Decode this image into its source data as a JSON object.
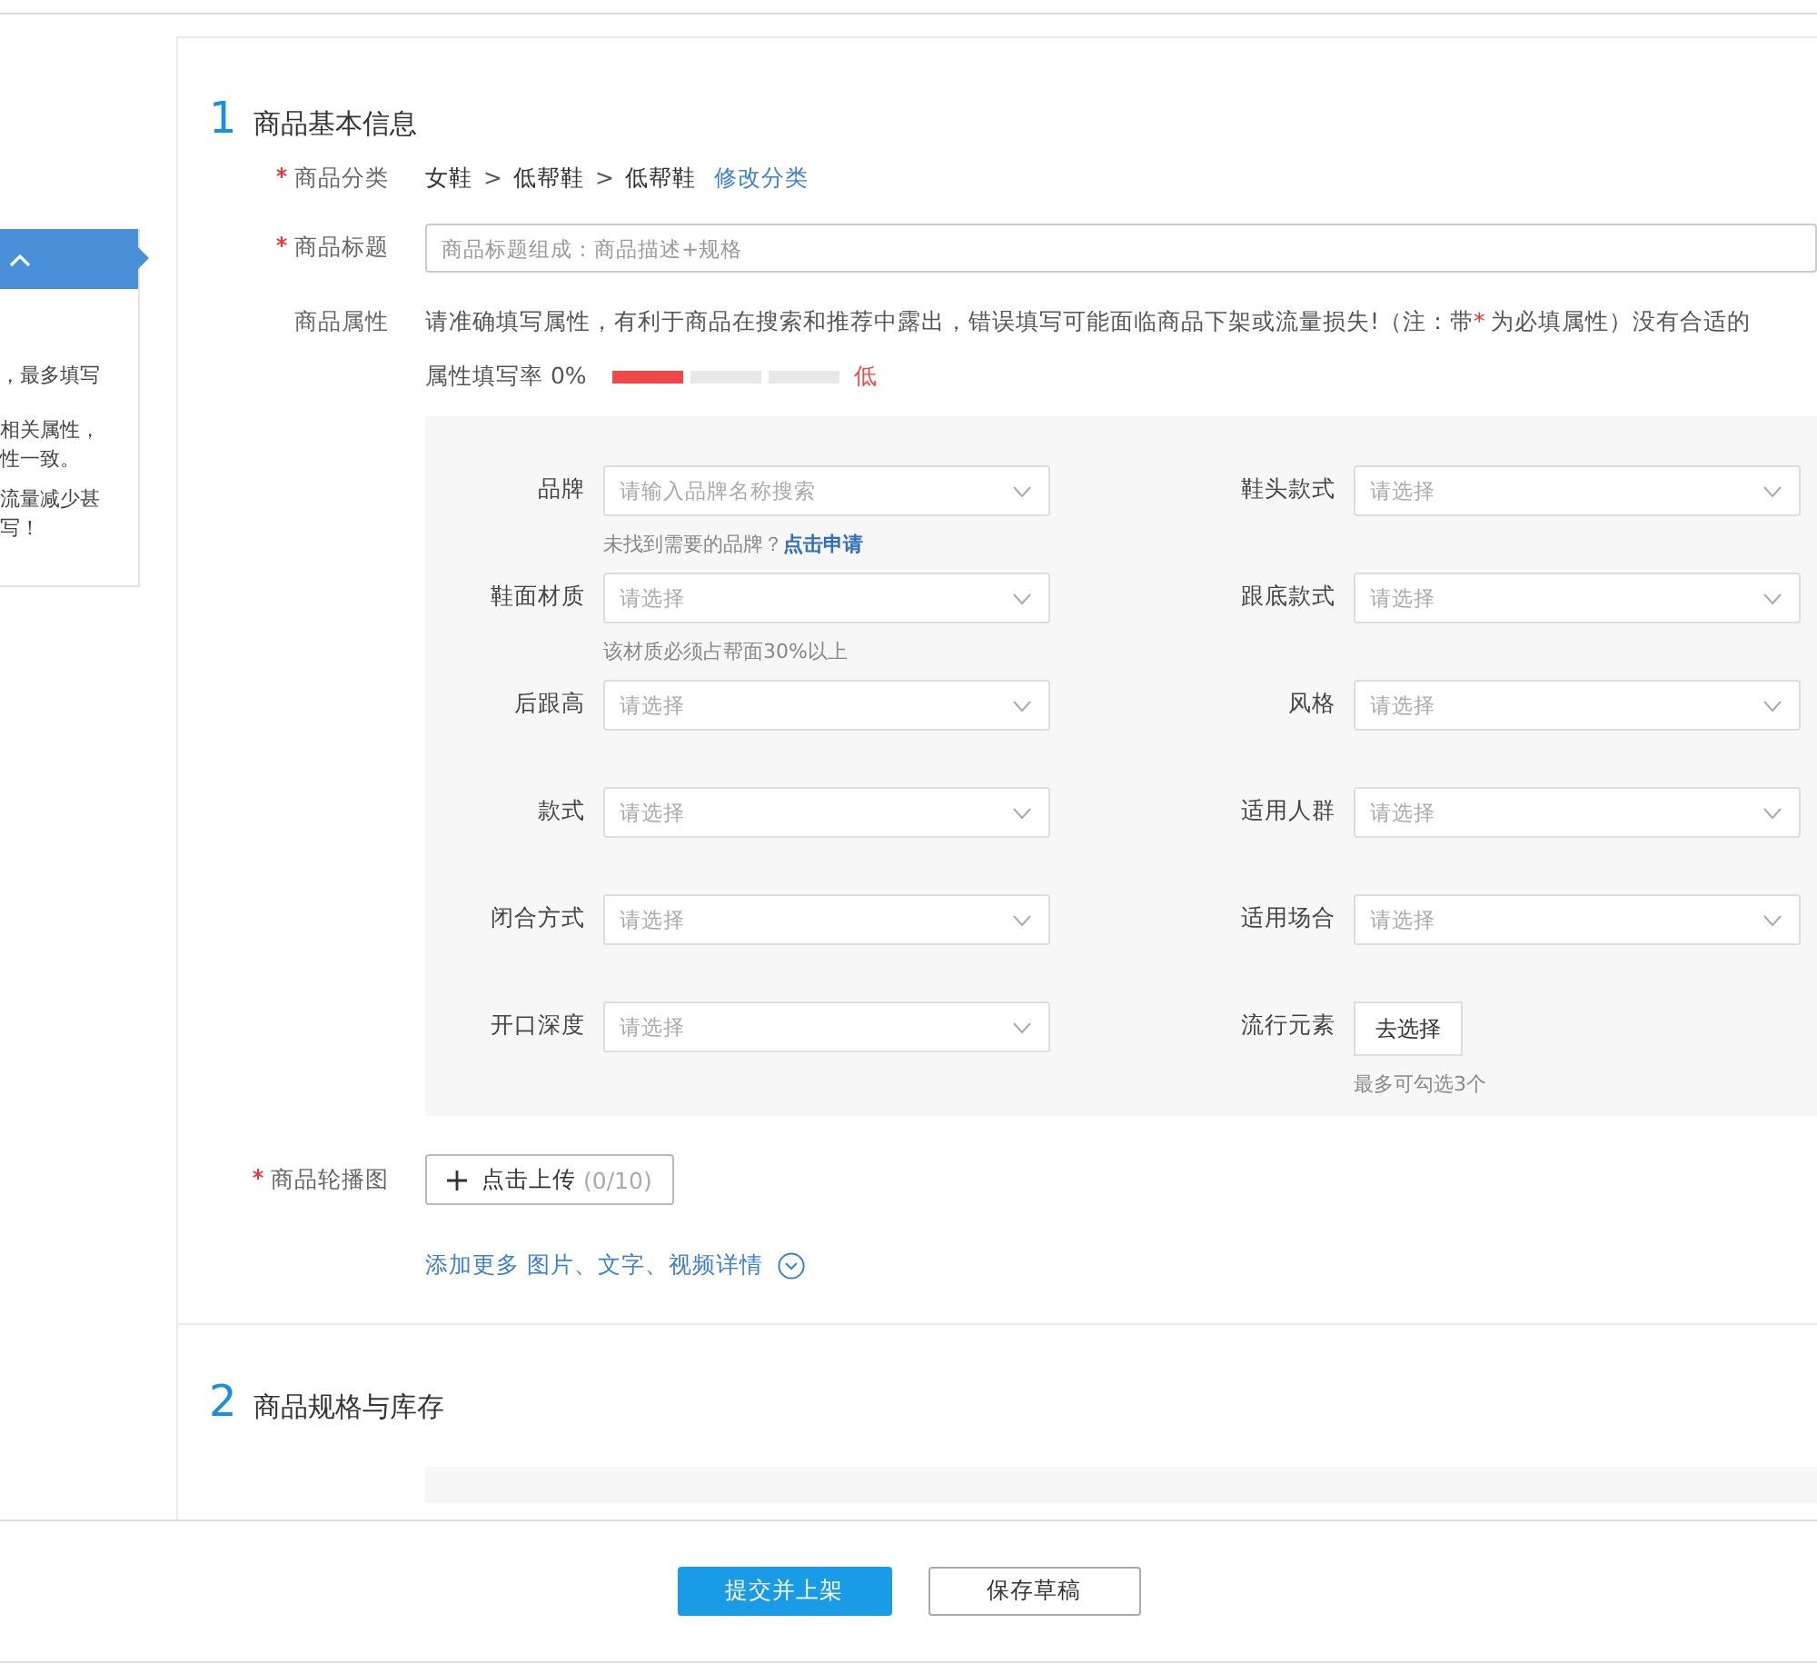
{
  "tip_panel": {
    "lines": [
      "，最多填写",
      "相关属性，",
      "性一致。",
      "流量减少甚",
      "写！"
    ]
  },
  "section1": {
    "number": "1",
    "title": "商品基本信息",
    "category": {
      "label": "商品分类",
      "required": true,
      "path": [
        "女鞋",
        "低帮鞋",
        "低帮鞋"
      ],
      "separator": ">",
      "action": "修改分类"
    },
    "title_field": {
      "label": "商品标题",
      "required": true,
      "placeholder": "商品标题组成：商品描述+规格"
    },
    "attributes": {
      "label": "商品属性",
      "required": false,
      "note": [
        {
          "kind": "plain",
          "text": "请准确填写属性，有利于商品在搜索和推荐中露出，错误填写可能面临商品下架或流量损失!（注：带"
        },
        {
          "kind": "mark",
          "text": "*"
        },
        {
          "kind": "plain",
          "text": "为必填属性）没有合适的"
        }
      ],
      "meter": {
        "label": "属性填写率 0%",
        "level": 0.33,
        "reading": "低"
      },
      "rows": [
        {
          "left": {
            "kind": "select",
            "label": "品牌",
            "placeholder": "请输入品牌名称搜索",
            "hint": "未找到需要的品牌？",
            "hint_link": "点击申请"
          },
          "right": {
            "kind": "select",
            "label": "鞋头款式",
            "placeholder": "请选择"
          }
        },
        {
          "left": {
            "kind": "select",
            "label": "鞋面材质",
            "placeholder": "请选择",
            "hint": "该材质必须占帮面30%以上"
          },
          "right": {
            "kind": "select",
            "label": "跟底款式",
            "placeholder": "请选择"
          }
        },
        {
          "left": {
            "kind": "select",
            "label": "后跟高",
            "placeholder": "请选择"
          },
          "right": {
            "kind": "select",
            "label": "风格",
            "placeholder": "请选择"
          }
        },
        {
          "left": {
            "kind": "select",
            "label": "款式",
            "placeholder": "请选择"
          },
          "right": {
            "kind": "select",
            "label": "适用人群",
            "placeholder": "请选择"
          }
        },
        {
          "left": {
            "kind": "select",
            "label": "闭合方式",
            "placeholder": "请选择"
          },
          "right": {
            "kind": "select",
            "label": "适用场合",
            "placeholder": "请选择"
          }
        },
        {
          "left": {
            "kind": "select",
            "label": "开口深度",
            "placeholder": "请选择"
          },
          "right": {
            "kind": "button",
            "label": "流行元素",
            "button": "去选择",
            "hint": "最多可勾选3个"
          }
        }
      ]
    },
    "carousel": {
      "label": "商品轮播图",
      "required": true,
      "button": "点击上传",
      "count": "(0/10)"
    },
    "more_link": "添加更多 图片、文字、视频详情"
  },
  "section2": {
    "number": "2",
    "title": "商品规格与库存"
  },
  "footer": {
    "submit": "提交并上架",
    "draft": "保存草稿"
  }
}
